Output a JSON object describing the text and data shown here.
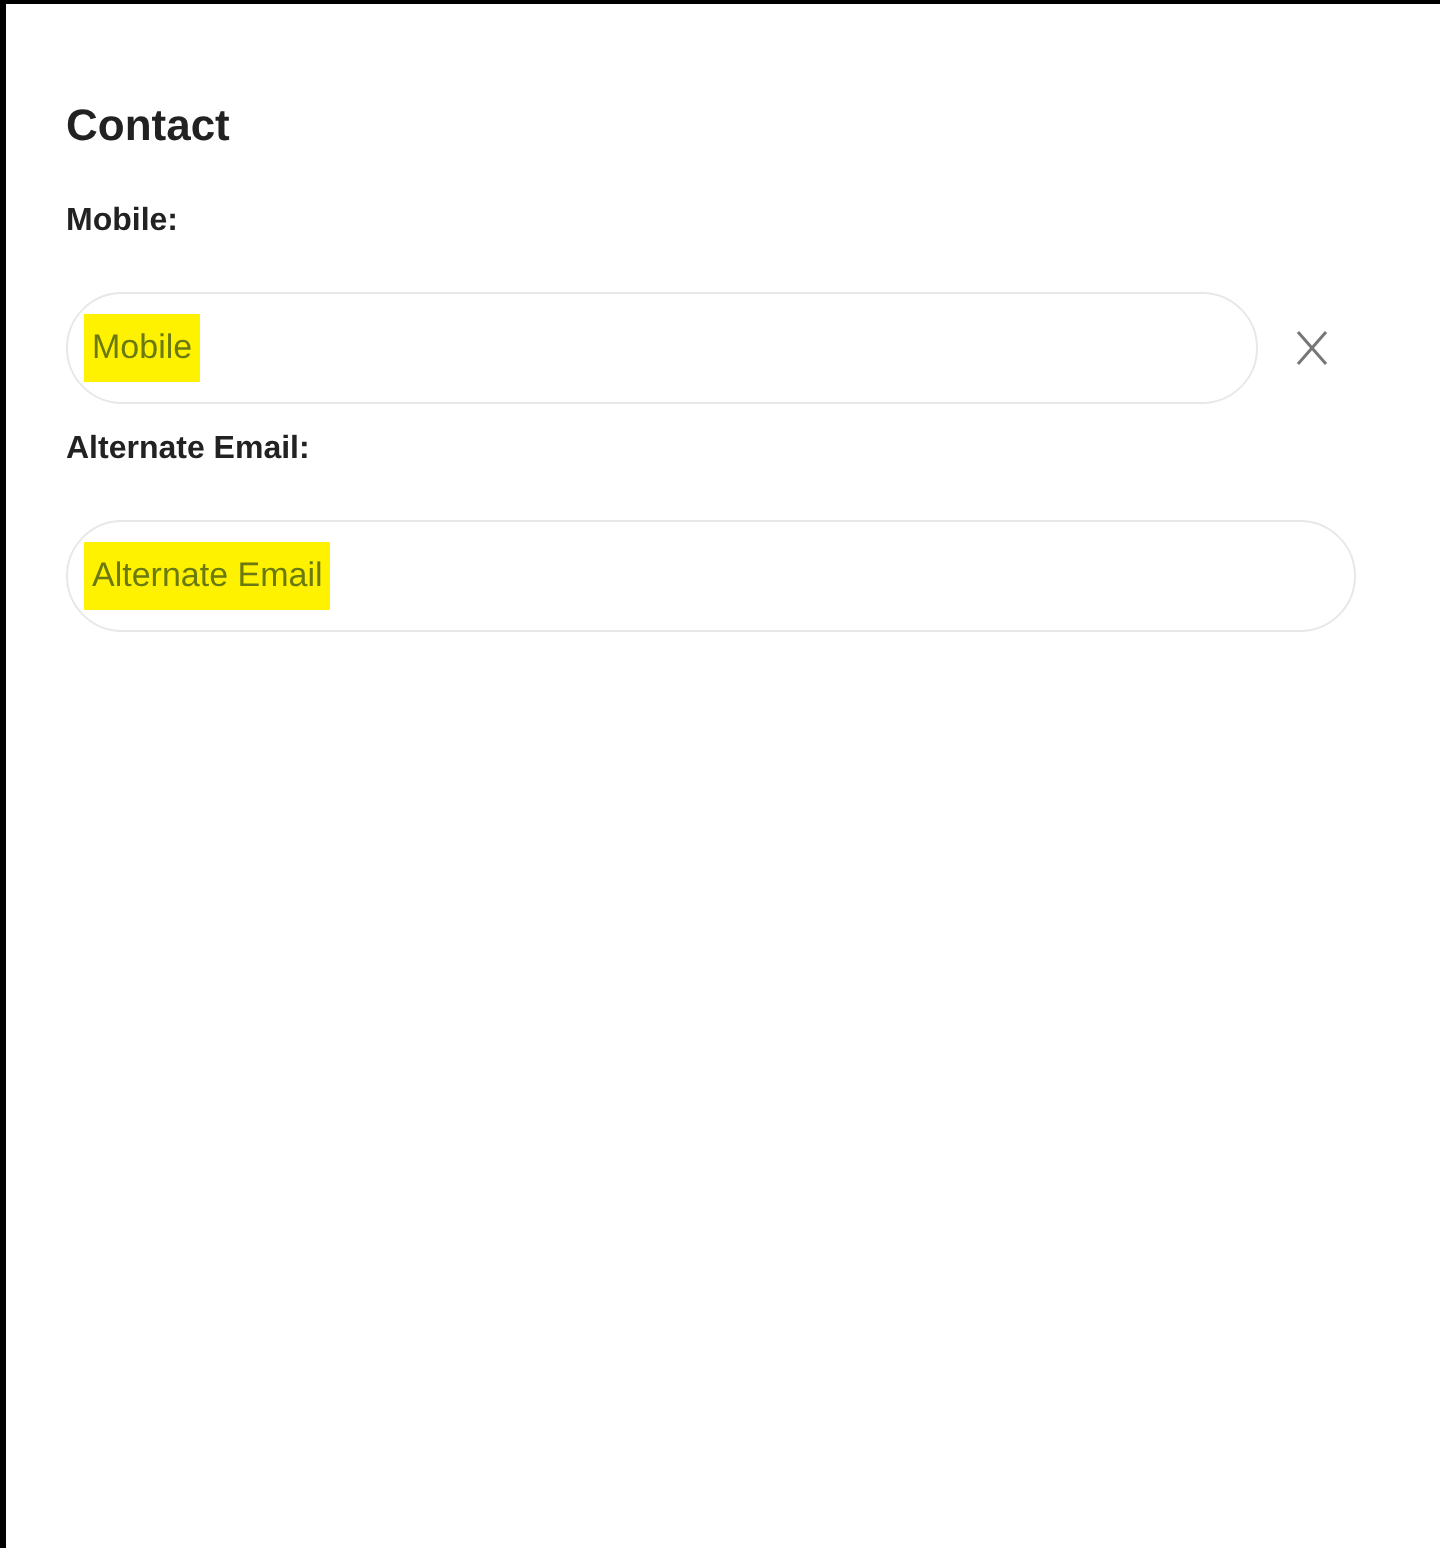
{
  "section": {
    "title": "Contact"
  },
  "fields": [
    {
      "label": "Mobile:",
      "placeholder": "Mobile",
      "highlighted": true,
      "clearable": true
    },
    {
      "label": "Alternate Email:",
      "placeholder": "Alternate Email",
      "highlighted": true,
      "clearable": false
    }
  ]
}
